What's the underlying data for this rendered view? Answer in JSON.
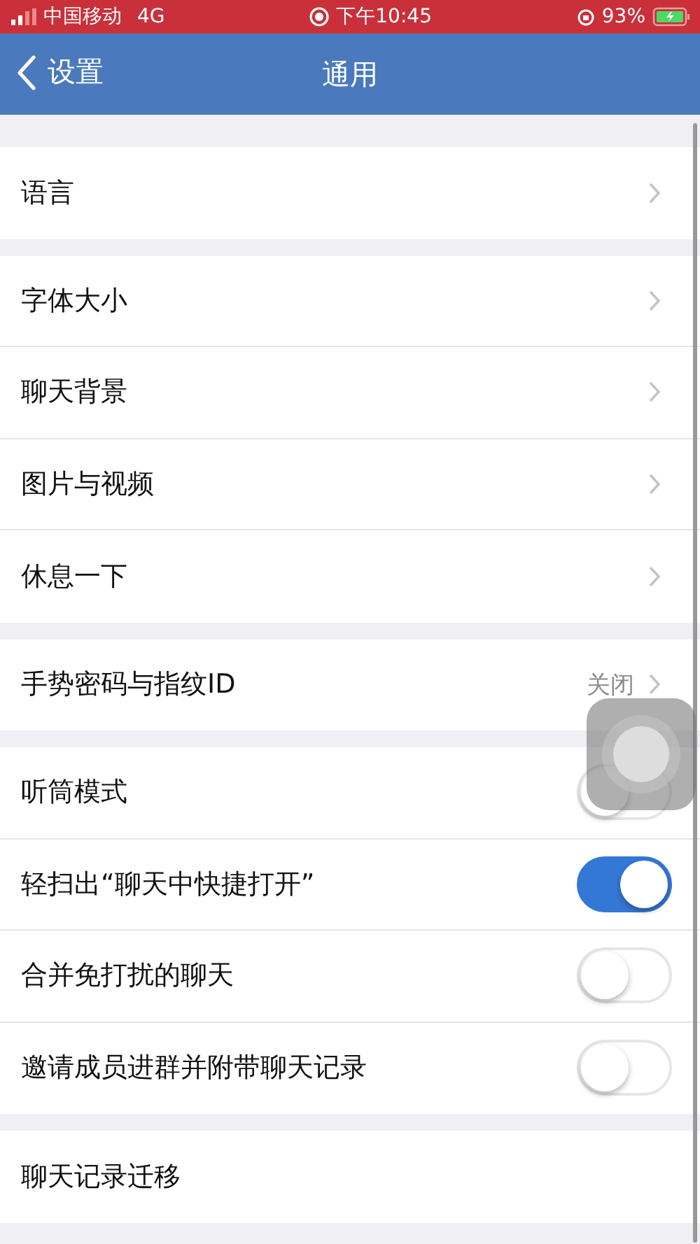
{
  "status_bar": {
    "carrier": "中国移动",
    "network": "4G",
    "time": "下午10:45",
    "battery": "93%"
  },
  "nav_bar": {
    "back": "设置",
    "title": "通用"
  },
  "groups": [
    {
      "items": [
        {
          "kind": "link",
          "label": "语言"
        }
      ]
    },
    {
      "items": [
        {
          "kind": "link",
          "label": "字体大小"
        },
        {
          "kind": "link",
          "label": "聊天背景"
        },
        {
          "kind": "link",
          "label": "图片与视频"
        },
        {
          "kind": "link",
          "label": "休息一下"
        }
      ]
    },
    {
      "items": [
        {
          "kind": "link",
          "label": "手势密码与指纹ID",
          "value": "关闭"
        }
      ]
    },
    {
      "items": [
        {
          "kind": "toggle",
          "label": "听筒模式",
          "on": false
        },
        {
          "kind": "toggle",
          "label": "轻扫出“聊天中快捷打开”",
          "on": true
        },
        {
          "kind": "toggle",
          "label": "合并免打扰的聊天",
          "on": false
        },
        {
          "kind": "toggle",
          "label": "邀请成员进群并附带聊天记录",
          "on": false
        }
      ]
    },
    {
      "items": [
        {
          "kind": "plain",
          "label": "聊天记录迁移"
        }
      ]
    }
  ]
}
